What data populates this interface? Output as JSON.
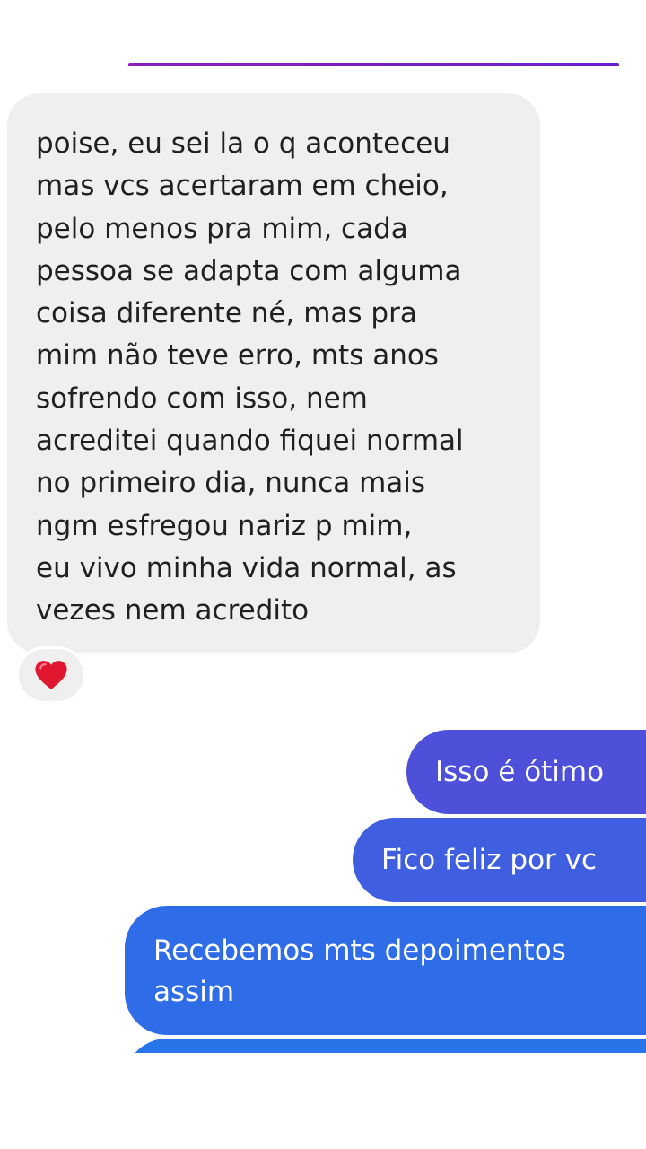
{
  "conversation": {
    "incoming": {
      "text": "poise, eu sei la o q aconteceu\nmas vcs acertaram em cheio,\npelo menos pra mim, cada\npessoa se adapta com alguma\ncoisa diferente né, mas pra\nmim não teve erro, mts anos\nsofrendo com isso, nem\nacreditei quando fiquei normal\nno primeiro dia, nunca mais\nngm esfregou nariz p mim,\neu vivo minha vida normal, as\nvezes nem acredito",
      "reaction": "heart-icon"
    },
    "outgoing": [
      {
        "text": "Isso é ótimo"
      },
      {
        "text": "Fico feliz por vc"
      },
      {
        "text": "Recebemos mts depoimentos\nassim"
      },
      {
        "text": ""
      }
    ]
  },
  "colors": {
    "divider": "#8a1fbe",
    "incoming_bubble": "#efefef",
    "outgoing_1": "#4f50d9",
    "outgoing_2": "#3f5fe0",
    "outgoing_3": "#2f6de8",
    "heart": "#e0172f"
  }
}
